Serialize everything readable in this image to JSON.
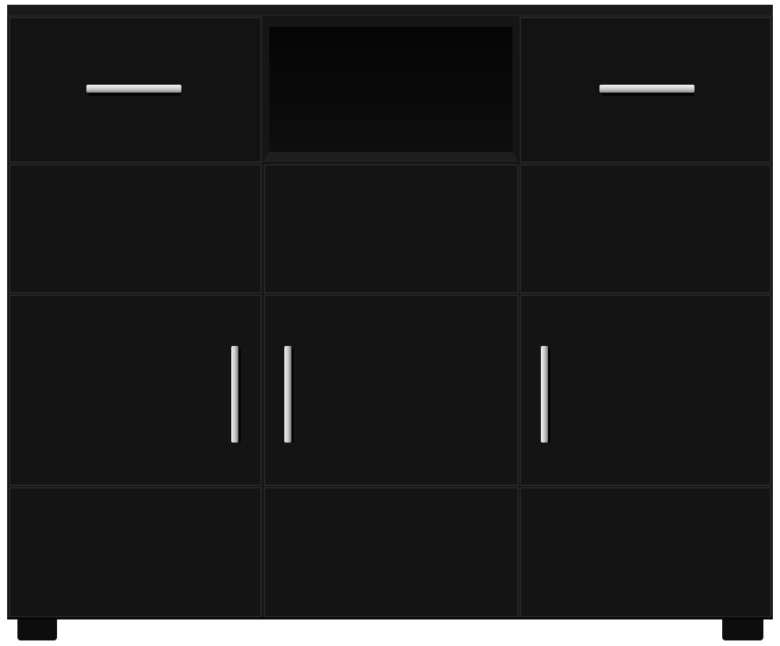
{
  "product": {
    "kind": "sideboard",
    "finish": "black",
    "colors": {
      "body": "#121212",
      "body_edge": "#1c1c1c",
      "panel_seam": "#2a2a2a",
      "niche_interior": "#070707",
      "handle": "#d8d8d8",
      "background": "#ffffff"
    },
    "top_drawers": [
      {
        "position": "left",
        "handle": "horizontal-bar"
      },
      {
        "position": "right",
        "handle": "horizontal-bar"
      }
    ],
    "open_compartment": {
      "position": "top-center"
    },
    "doors": [
      {
        "position": "left",
        "handle": "vertical-bar",
        "handle_side": "right"
      },
      {
        "position": "center",
        "handle": "vertical-bar",
        "handle_side": "left"
      },
      {
        "position": "right",
        "handle": "vertical-bar",
        "handle_side": "left"
      }
    ],
    "feet_count": 2
  }
}
